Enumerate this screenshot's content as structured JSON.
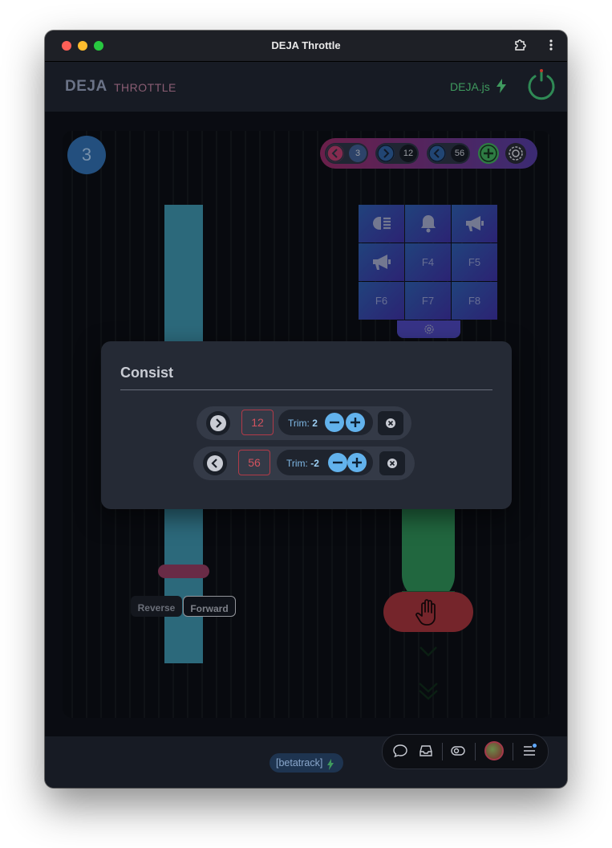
{
  "window": {
    "title": "DEJA Throttle"
  },
  "header": {
    "brand_main": "DEJA",
    "brand_sub": "THROTTLE",
    "server_label": "DEJA.js"
  },
  "throttle": {
    "loco_address": "3",
    "consist_bar": {
      "locos": [
        {
          "direction": "reverse",
          "address": "3"
        },
        {
          "direction": "forward",
          "address": "12"
        },
        {
          "direction": "reverse",
          "address": "56"
        }
      ]
    },
    "direction": {
      "reverse_label": "Reverse",
      "forward_label": "Forward",
      "selected": "Forward"
    },
    "functions": [
      {
        "id": "F0",
        "icon": "headlight-icon"
      },
      {
        "id": "F1",
        "icon": "bell-icon"
      },
      {
        "id": "F2",
        "icon": "horn-icon"
      },
      {
        "id": "F3",
        "icon": "horn-icon"
      },
      {
        "id": "F4",
        "label": "F4"
      },
      {
        "id": "F5",
        "label": "F5"
      },
      {
        "id": "F6",
        "label": "F6"
      },
      {
        "id": "F7",
        "label": "F7"
      },
      {
        "id": "F8",
        "label": "F8"
      }
    ]
  },
  "consist_dialog": {
    "title": "Consist",
    "rows": [
      {
        "direction": "forward",
        "address": "12",
        "trim_label": "Trim:",
        "trim_value": "2"
      },
      {
        "direction": "reverse",
        "address": "56",
        "trim_label": "Trim:",
        "trim_value": "-2"
      }
    ]
  },
  "footer": {
    "layout_pill": "[betatrack]"
  },
  "colors": {
    "accent_blue": "#62b2ec",
    "stop_red": "#9c323a",
    "speed_green": "#2c8a55",
    "throttle_bar": "#3b8ca4"
  }
}
